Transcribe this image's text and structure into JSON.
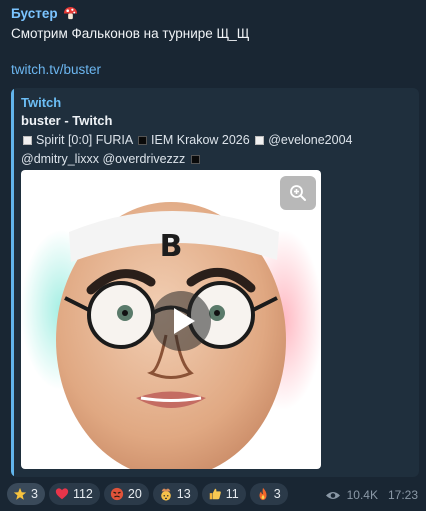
{
  "message": {
    "author": "Бустер",
    "author_emoji": "mushroom-icon",
    "text": "Смотрим Фальконов на турнире Щ_Щ",
    "link": "twitch.tv/buster"
  },
  "preview": {
    "site": "Twitch",
    "title": "buster - Twitch",
    "desc_parts": {
      "p1": "Spirit [0:0] FURIA",
      "p2": "IEM Krakow 2026",
      "p3": "@evelone2004",
      "p4": "@dmitry_lixxx @overdrivezzz"
    },
    "thumbnail_letter": "B"
  },
  "reactions": [
    {
      "icon": "star-icon",
      "count": "3"
    },
    {
      "icon": "heart-icon",
      "count": "112"
    },
    {
      "icon": "angry-face-icon",
      "count": "20"
    },
    {
      "icon": "exploding-head-icon",
      "count": "13"
    },
    {
      "icon": "thumbs-up-icon",
      "count": "11"
    },
    {
      "icon": "fire-icon",
      "count": "3"
    }
  ],
  "meta": {
    "views": "10.4K",
    "time": "17:23"
  },
  "colors": {
    "accent": "#6cbef5",
    "background": "#192633",
    "chip": "#2b3a49"
  }
}
